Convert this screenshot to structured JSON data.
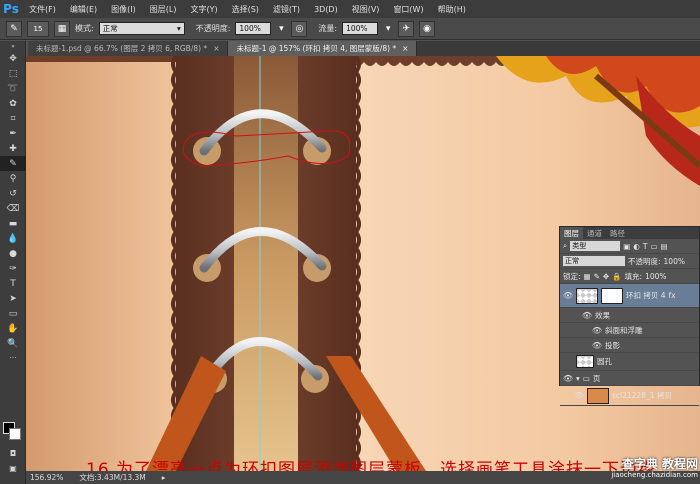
{
  "app": {
    "logo": "Ps"
  },
  "menu": [
    "文件(F)",
    "编辑(E)",
    "图像(I)",
    "图层(L)",
    "文字(Y)",
    "选择(S)",
    "滤镜(T)",
    "3D(D)",
    "视图(V)",
    "窗口(W)",
    "帮助(H)"
  ],
  "options": {
    "brush_size": "15",
    "mode_label": "模式:",
    "mode_value": "正常",
    "opacity_label": "不透明度:",
    "opacity_value": "100%",
    "flow_label": "流量:",
    "flow_value": "100%"
  },
  "tabs": [
    {
      "label": "未标题-1.psd @ 66.7% (图层 2 拷贝 6, RGB/8) *",
      "close": "×"
    },
    {
      "label": "未标题-1 @ 157% (环扣 拷贝 4, 图层蒙版/8) *",
      "close": "×"
    }
  ],
  "status": {
    "zoom": "156.92%",
    "doc": "文档:3.43M/13.3M"
  },
  "layers_panel": {
    "tabs": [
      "图层",
      "通道",
      "路径"
    ],
    "filter_label": "类型",
    "blend_mode": "正常",
    "opacity_label": "不透明度:",
    "opacity_value": "100%",
    "lock_label": "锁定:",
    "fill_label": "填充:",
    "fill_value": "100%",
    "layers": [
      {
        "name": "环扣 拷贝 4",
        "fx": "fx"
      },
      {
        "name": "效果"
      },
      {
        "name": "斜面和浮雕"
      },
      {
        "name": "投影"
      },
      {
        "name": "圆孔"
      },
      {
        "name": "页"
      },
      {
        "name": "scl21228_1 拷贝"
      }
    ]
  },
  "annotation": "16.为了漂亮一点为环扣图层添加图层蒙板，选择画笔工具涂抹一下边缘。",
  "watermark": {
    "line1": "查字典 教程网",
    "line2": "jiaocheng.chazidian.com"
  },
  "colors": {
    "annotation": "#cc0000",
    "canvas_bg": "#f3c9a2",
    "strip": "#6b3b28"
  }
}
